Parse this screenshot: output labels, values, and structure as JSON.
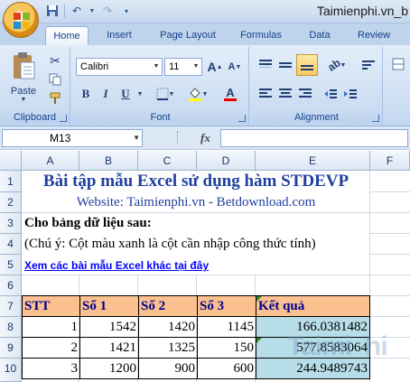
{
  "titlebar": {
    "brand": "Taimienphi.vn_b"
  },
  "tabs": [
    "Home",
    "Insert",
    "Page Layout",
    "Formulas",
    "Data",
    "Review"
  ],
  "ribbon": {
    "clipboard": {
      "paste_label": "Paste",
      "group_label": "Clipboard"
    },
    "font": {
      "family": "Calibri",
      "size": "11",
      "group_label": "Font",
      "bold": "B",
      "italic": "I",
      "underline": "U",
      "grow": "A",
      "shrink": "A",
      "font_color_glyph": "A"
    },
    "alignment": {
      "group_label": "Alignment"
    }
  },
  "formula_bar": {
    "name_box": "M13",
    "fx": "fx",
    "formula": ""
  },
  "columns": [
    "A",
    "B",
    "C",
    "D",
    "E",
    "F"
  ],
  "rows": [
    "1",
    "2",
    "3",
    "4",
    "5",
    "6",
    "7",
    "8",
    "9",
    "10"
  ],
  "sheet": {
    "title": "Bài tập mẫu Excel sử dụng hàm STDEVP",
    "website": "Website: Taimienphi.vn - Betdownload.com",
    "instruction": "Cho bảng dữ liệu sau:",
    "note": "(Chú ý: Cột màu xanh là cột cần nhập công thức tính)",
    "link": "Xem các bài mẫu Excel khác tại đây",
    "table_headers": [
      "STT",
      "Số 1",
      "Số 2",
      "Số 3",
      "Kết quả"
    ],
    "table_rows": [
      [
        "1",
        "1542",
        "1420",
        "1145",
        "166.0381482"
      ],
      [
        "2",
        "1421",
        "1325",
        "150",
        "577.8583064"
      ],
      [
        "3",
        "1200",
        "900",
        "600",
        "244.9489743"
      ]
    ]
  },
  "colors": {
    "header_fill": "#fac090",
    "result_fill": "#b7dee8",
    "title_color": "#1f3f9f",
    "link_color": "#0000ff"
  }
}
